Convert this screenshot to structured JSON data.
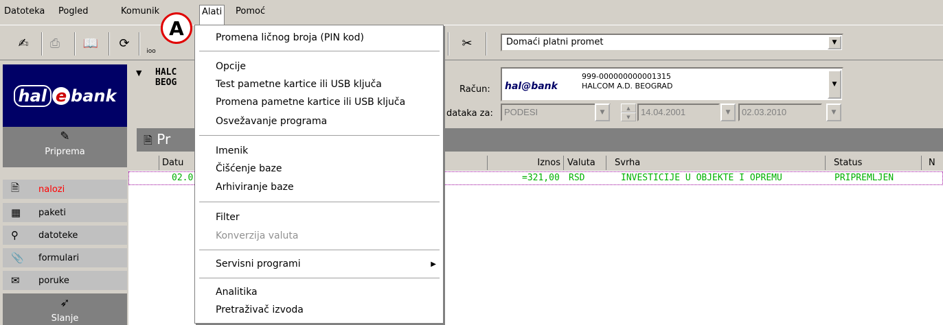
{
  "menubar": {
    "items": [
      "Datoteka",
      "Pogled",
      "Komunik",
      "Alati",
      "Pomoć"
    ]
  },
  "toolbar": {
    "top_label": "ioo",
    "payment_type": "Domaći platni promet"
  },
  "sidebar": {
    "logo_hal": "hal",
    "logo_e": "e",
    "logo_bank": "bank",
    "section_prep": "Priprema",
    "section_send": "Slanje",
    "items": [
      "nalozi",
      "paketi",
      "datoteke",
      "formulari",
      "poruke"
    ]
  },
  "header": {
    "org_line1": "HALC",
    "org_line2": "BEOG"
  },
  "account": {
    "label": "Račun:",
    "logo": "hal@bank",
    "number": "999-000000000001315",
    "name": "HALCOM A.D. BEOGRAD"
  },
  "filter": {
    "label": "dataka za:",
    "period": "PODESI",
    "date_from": "14.04.2001",
    "date_to": "02.03.2010"
  },
  "title_bar": {
    "text": "Pr"
  },
  "table": {
    "headers": [
      "Datu",
      "Iznos",
      "Valuta",
      "Svrha",
      "Status",
      "N"
    ],
    "row": {
      "date": "02.0",
      "amount": "=321,00",
      "currency": "RSD",
      "purpose": "INVESTICIJE U OBJEKTE I OPREMU",
      "status": "PRIPREMLJEN"
    }
  },
  "menu": {
    "items": [
      "Promena ličnog broja (PIN kod)",
      "Opcije",
      "Test pametne kartice ili USB ključa",
      "Promena pametne kartice ili USB ključa",
      "Osvežavanje programa",
      "Imenik",
      "Čišćenje baze",
      "Arhiviranje baze",
      "Filter",
      "Konverzija valuta",
      "Servisni programi",
      "Analitika",
      "Pretraživač izvoda"
    ]
  },
  "badge": {
    "letter": "A"
  }
}
